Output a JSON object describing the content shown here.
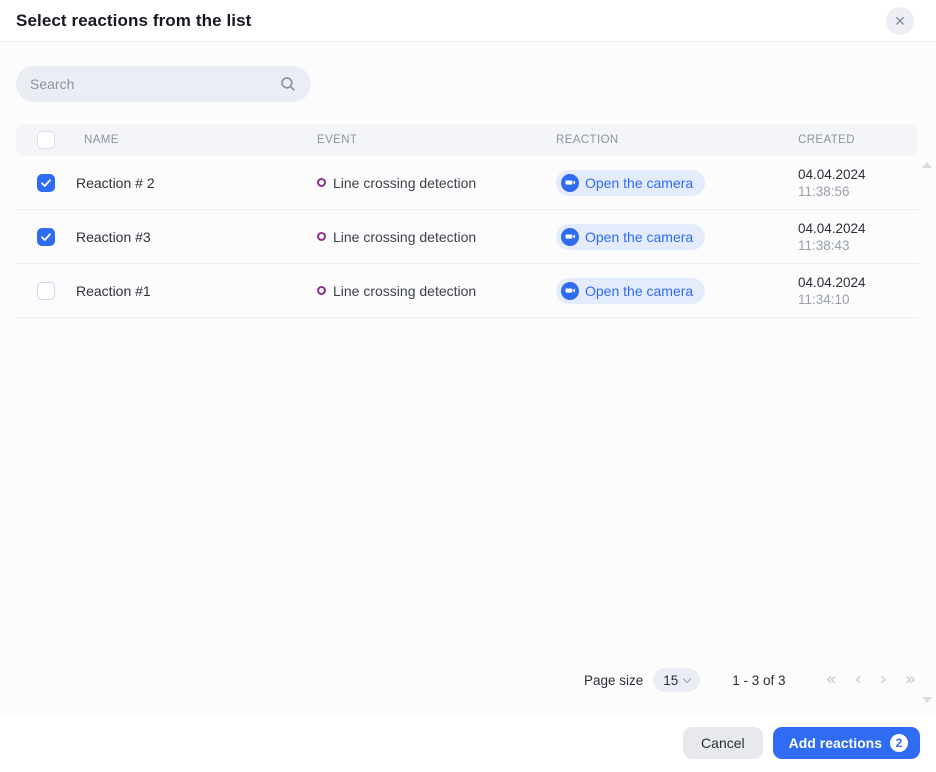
{
  "dialog": {
    "title": "Select reactions from the list"
  },
  "search": {
    "placeholder": "Search"
  },
  "table": {
    "header": {
      "name": "NAME",
      "event": "EVENT",
      "reaction": "REACTION",
      "created": "CREATED"
    },
    "rows": [
      {
        "checked": true,
        "name": "Reaction # 2",
        "event": "Line crossing detection",
        "reaction": "Open the camera",
        "created_date": "04.04.2024",
        "created_time": "11:38:56"
      },
      {
        "checked": true,
        "name": "Reaction #3",
        "event": "Line crossing detection",
        "reaction": "Open the camera",
        "created_date": "04.04.2024",
        "created_time": "11:38:43"
      },
      {
        "checked": false,
        "name": "Reaction #1",
        "event": "Line crossing detection",
        "reaction": "Open the camera",
        "created_date": "04.04.2024",
        "created_time": "11:34:10"
      }
    ]
  },
  "pagination": {
    "page_size_label": "Page size",
    "page_size_value": "15",
    "range_text": "1 - 3 of 3",
    "first": "«",
    "prev": "‹",
    "next": "›",
    "last": "»"
  },
  "footer": {
    "cancel_label": "Cancel",
    "add_label": "Add reactions",
    "selected_count": "2"
  },
  "colors": {
    "accent_blue": "#2f6bf3",
    "reaction_badge_bg": "#e4ecfc",
    "event_icon_purple": "#8b2f8a"
  }
}
